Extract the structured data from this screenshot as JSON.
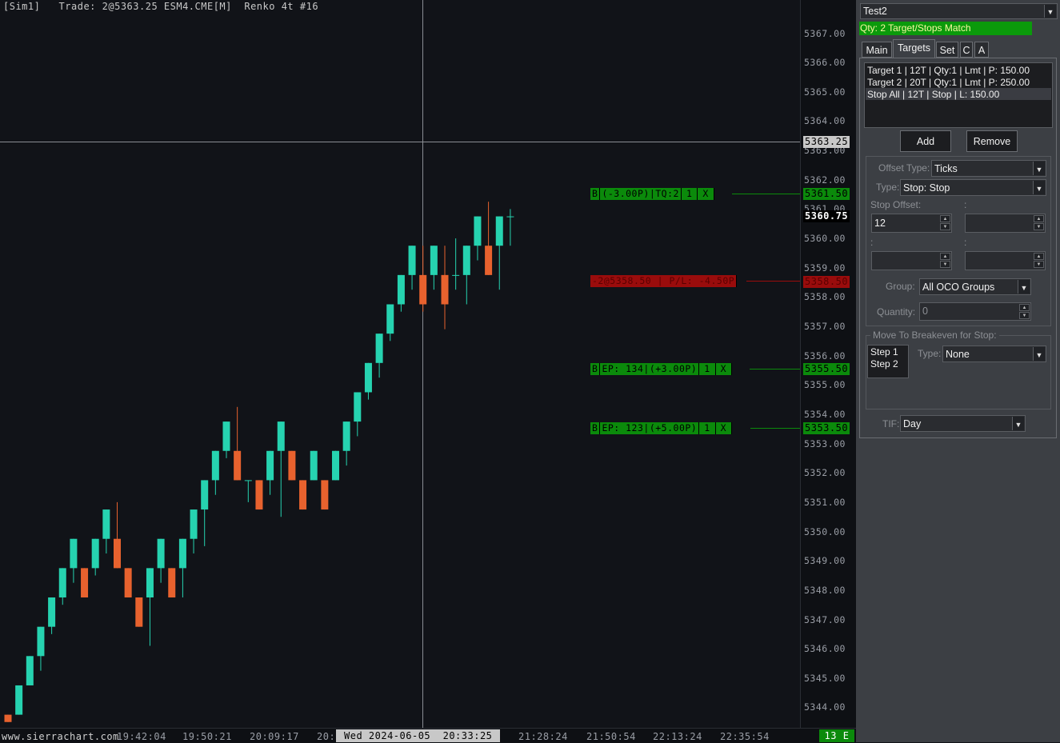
{
  "chart": {
    "header": {
      "account": "[Sim1]",
      "trade_label": "Trade:",
      "trade_value": "2@5363.25",
      "symbol": "ESM4.CME[M]",
      "bar_type": "Renko 4t #16"
    },
    "y_ticks": [
      "5367.00",
      "5366.00",
      "5365.00",
      "5364.00",
      "5363.00",
      "5362.00",
      "5361.00",
      "5360.00",
      "5359.00",
      "5358.00",
      "5357.00",
      "5356.00",
      "5355.00",
      "5354.00",
      "5353.00",
      "5352.00",
      "5351.00",
      "5350.00",
      "5349.00",
      "5348.00",
      "5347.00",
      "5346.00",
      "5345.00",
      "5344.00"
    ],
    "price_labels": {
      "crosshair": "5363.25",
      "last": "5360.75",
      "target_top": "5361.50",
      "position": "5358.50",
      "order_mid": "5355.50",
      "order_low": "5353.50"
    },
    "x_axis": {
      "website": "www.sierrachart.com",
      "times": [
        "19:42:04",
        "19:50:21",
        "20:09:17",
        "20:",
        "21:28:24",
        "21:50:54",
        "22:13:24",
        "22:35:54"
      ],
      "cursor_date": "Wed 2024-06-05  20:33:25",
      "status": "13 E"
    },
    "orders": {
      "top": {
        "side": "B",
        "info": "(-3.00P)|TQ:2",
        "qty": "1",
        "close": "X"
      },
      "position": {
        "text": "-2@5358.50 | P/L: -4.50P"
      },
      "mid": {
        "side": "B",
        "info": "EP: 134|(+3.00P)",
        "qty": "1",
        "close": "X"
      },
      "low": {
        "side": "B",
        "info": "EP: 123|(+5.00P)",
        "qty": "1",
        "close": "X"
      }
    },
    "colors": {
      "up": "#26d3b0",
      "down": "#e8622e",
      "order_green": "#0b8a0b",
      "order_red": "#9a0c0c"
    },
    "chart_data": {
      "type": "candlestick",
      "ylim": [
        5343.5,
        5367.5
      ],
      "bars": [
        {
          "o": 5343.75,
          "h": 5343.75,
          "l": 5343.5,
          "c": 5343.5
        },
        {
          "o": 5343.75,
          "h": 5344.75,
          "l": 5343.75,
          "c": 5344.75
        },
        {
          "o": 5344.75,
          "h": 5345.75,
          "l": 5344.75,
          "c": 5345.75
        },
        {
          "o": 5345.75,
          "h": 5346.75,
          "l": 5345.25,
          "c": 5346.75
        },
        {
          "o": 5346.75,
          "h": 5347.75,
          "l": 5346.5,
          "c": 5347.75
        },
        {
          "o": 5347.75,
          "h": 5348.75,
          "l": 5347.5,
          "c": 5348.75
        },
        {
          "o": 5348.75,
          "h": 5349.75,
          "l": 5348.25,
          "c": 5349.75
        },
        {
          "o": 5348.75,
          "h": 5348.75,
          "l": 5347.75,
          "c": 5347.75
        },
        {
          "o": 5348.75,
          "h": 5349.75,
          "l": 5348.5,
          "c": 5349.75
        },
        {
          "o": 5349.75,
          "h": 5350.75,
          "l": 5349.25,
          "c": 5350.75
        },
        {
          "o": 5349.75,
          "h": 5351.0,
          "l": 5348.75,
          "c": 5348.75
        },
        {
          "o": 5348.75,
          "h": 5348.75,
          "l": 5347.75,
          "c": 5347.75
        },
        {
          "o": 5347.75,
          "h": 5347.75,
          "l": 5346.75,
          "c": 5346.75
        },
        {
          "o": 5347.75,
          "h": 5348.75,
          "l": 5346.1,
          "c": 5348.75
        },
        {
          "o": 5348.75,
          "h": 5349.75,
          "l": 5348.25,
          "c": 5349.75
        },
        {
          "o": 5348.75,
          "h": 5348.75,
          "l": 5347.75,
          "c": 5347.75
        },
        {
          "o": 5348.75,
          "h": 5349.75,
          "l": 5347.75,
          "c": 5349.75
        },
        {
          "o": 5349.75,
          "h": 5350.75,
          "l": 5349.25,
          "c": 5350.75
        },
        {
          "o": 5350.75,
          "h": 5351.75,
          "l": 5349.5,
          "c": 5351.75
        },
        {
          "o": 5351.75,
          "h": 5352.75,
          "l": 5351.25,
          "c": 5352.75
        },
        {
          "o": 5352.75,
          "h": 5353.75,
          "l": 5352.5,
          "c": 5353.75
        },
        {
          "o": 5352.75,
          "h": 5354.25,
          "l": 5351.75,
          "c": 5351.75
        },
        {
          "o": 5351.75,
          "h": 5351.75,
          "l": 5351.0,
          "c": 5351.75
        },
        {
          "o": 5351.75,
          "h": 5351.75,
          "l": 5350.75,
          "c": 5350.75
        },
        {
          "o": 5351.75,
          "h": 5352.75,
          "l": 5351.25,
          "c": 5352.75
        },
        {
          "o": 5352.75,
          "h": 5353.75,
          "l": 5350.5,
          "c": 5353.75
        },
        {
          "o": 5352.75,
          "h": 5352.75,
          "l": 5351.75,
          "c": 5351.75
        },
        {
          "o": 5351.75,
          "h": 5351.75,
          "l": 5350.75,
          "c": 5350.75
        },
        {
          "o": 5351.75,
          "h": 5352.75,
          "l": 5351.75,
          "c": 5352.75
        },
        {
          "o": 5351.75,
          "h": 5351.75,
          "l": 5350.75,
          "c": 5350.75
        },
        {
          "o": 5351.75,
          "h": 5352.75,
          "l": 5351.75,
          "c": 5352.75
        },
        {
          "o": 5352.75,
          "h": 5353.75,
          "l": 5352.25,
          "c": 5353.75
        },
        {
          "o": 5353.75,
          "h": 5354.75,
          "l": 5353.25,
          "c": 5354.75
        },
        {
          "o": 5354.75,
          "h": 5355.75,
          "l": 5354.5,
          "c": 5355.75
        },
        {
          "o": 5355.75,
          "h": 5356.75,
          "l": 5355.25,
          "c": 5356.75
        },
        {
          "o": 5356.75,
          "h": 5357.75,
          "l": 5356.5,
          "c": 5357.75
        },
        {
          "o": 5357.75,
          "h": 5358.75,
          "l": 5357.5,
          "c": 5358.75
        },
        {
          "o": 5358.75,
          "h": 5359.75,
          "l": 5358.25,
          "c": 5359.75
        },
        {
          "o": 5358.75,
          "h": 5359.75,
          "l": 5357.5,
          "c": 5357.75
        },
        {
          "o": 5358.75,
          "h": 5359.75,
          "l": 5358.25,
          "c": 5359.75
        },
        {
          "o": 5358.75,
          "h": 5359.75,
          "l": 5356.9,
          "c": 5357.75
        },
        {
          "o": 5358.75,
          "h": 5360.0,
          "l": 5358.25,
          "c": 5358.75
        },
        {
          "o": 5358.75,
          "h": 5359.75,
          "l": 5357.75,
          "c": 5359.75
        },
        {
          "o": 5359.75,
          "h": 5360.75,
          "l": 5359.25,
          "c": 5360.75
        },
        {
          "o": 5359.75,
          "h": 5361.25,
          "l": 5358.75,
          "c": 5358.75
        },
        {
          "o": 5359.75,
          "h": 5360.75,
          "l": 5358.25,
          "c": 5360.75
        },
        {
          "o": 5360.75,
          "h": 5361.0,
          "l": 5359.75,
          "c": 5360.75
        }
      ]
    }
  },
  "panel": {
    "account_select": "Test2",
    "status": "Qty: 2 Target/Stops Match",
    "tabs": [
      "Main",
      "Targets",
      "Set",
      "C",
      "A"
    ],
    "target_list": [
      "Target 1 | 12T | Qty:1 | Lmt | P: 150.00",
      "Target 2 | 20T | Qty:1 | Lmt | P: 250.00",
      "Stop All | 12T | Stop | L: 150.00"
    ],
    "add_label": "Add",
    "remove_label": "Remove",
    "offset_type_label": "Offset Type:",
    "offset_type_value": "Ticks",
    "type_label": "Type:",
    "type_value": "Stop: Stop",
    "stop_offset_label": "Stop Offset:",
    "stop_offset_value": "12",
    "group_label": "Group:",
    "group_value": "All OCO Groups",
    "quantity_label": "Quantity:",
    "quantity_value": "0",
    "breakeven_label": "Move To Breakeven for Stop:",
    "steps": [
      "Step 1",
      "Step 2"
    ],
    "be_type_label": "Type:",
    "be_type_value": "None",
    "tif_label": "TIF:",
    "tif_value": "Day"
  }
}
